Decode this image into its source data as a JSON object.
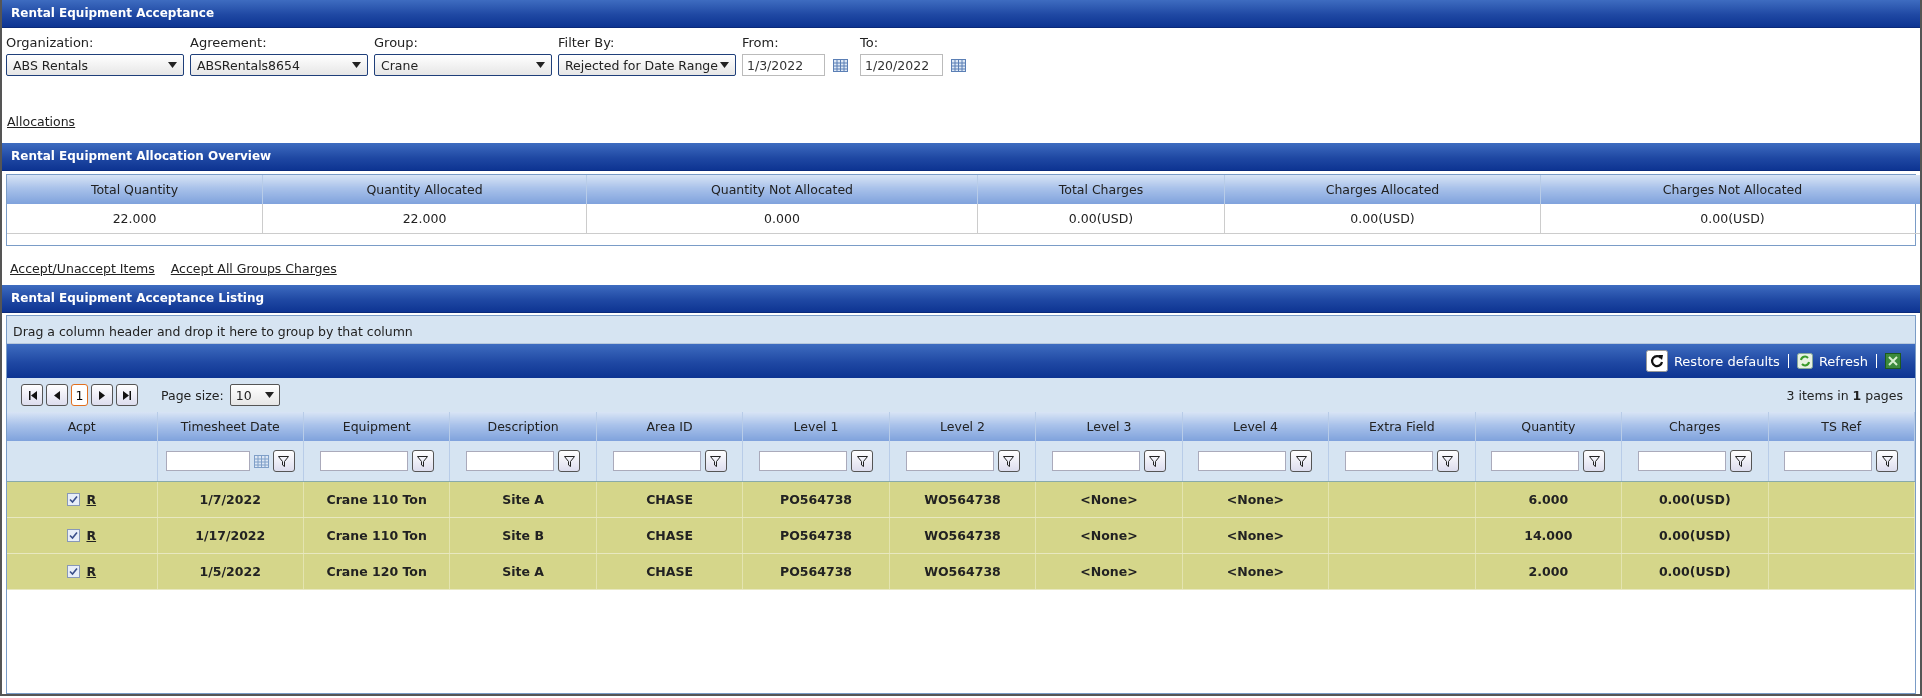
{
  "window": {
    "title": "Rental Equipment Acceptance"
  },
  "filters": [
    {
      "kind": "select",
      "label": "Organization:",
      "value": "ABS Rentals"
    },
    {
      "kind": "select",
      "label": "Agreement:",
      "value": "ABSRentals8654"
    },
    {
      "kind": "select",
      "label": "Group:",
      "value": "Crane"
    },
    {
      "kind": "select",
      "label": "Filter By:",
      "value": "Rejected for Date Range"
    },
    {
      "kind": "date",
      "label": "From:",
      "value": "1/3/2022"
    },
    {
      "kind": "date",
      "label": "To:",
      "value": "1/20/2022"
    }
  ],
  "allocations_link": "Allocations",
  "overview": {
    "title": "Rental Equipment Allocation Overview",
    "columns": [
      "Total Quantity",
      "Quantity Allocated",
      "Quantity Not Allocated",
      "Total Charges",
      "Charges Allocated",
      "Charges Not Allocated"
    ],
    "rows": [
      [
        "22.000",
        "22.000",
        "0.000",
        "0.00(USD)",
        "0.00(USD)",
        "0.00(USD)"
      ]
    ]
  },
  "action_links": [
    "Accept/Unaccept Items",
    "Accept All Groups Charges"
  ],
  "listing": {
    "title": "Rental Equipment Acceptance Listing",
    "group_hint": "Drag a column header and drop it here to group by that column",
    "toolbar": [
      {
        "kind": "restore",
        "label": "Restore defaults"
      },
      {
        "kind": "refresh",
        "label": "Refresh"
      },
      {
        "kind": "export"
      }
    ],
    "pager": {
      "pages": [
        {
          "label": "1",
          "selected": true
        }
      ],
      "page_size_label": "Page size:",
      "page_size": "10",
      "summary": "3 items in **1** pages"
    },
    "columns": [
      {
        "label": "Acpt",
        "kind": "none"
      },
      {
        "label": "Timesheet Date",
        "kind": "date"
      },
      {
        "label": "Equipment",
        "kind": "text"
      },
      {
        "label": "Description",
        "kind": "text"
      },
      {
        "label": "Area ID",
        "kind": "text"
      },
      {
        "label": "Level 1",
        "kind": "text"
      },
      {
        "label": "Level 2",
        "kind": "text"
      },
      {
        "label": "Level 3",
        "kind": "text"
      },
      {
        "label": "Level 4",
        "kind": "text"
      },
      {
        "label": "Extra Field",
        "kind": "text"
      },
      {
        "label": "Quantity",
        "kind": "text"
      },
      {
        "label": "Charges",
        "kind": "text"
      },
      {
        "label": "TS Ref",
        "kind": "text"
      }
    ],
    "rows": [
      {
        "checked": true,
        "cells": [
          "R",
          "1/7/2022",
          "Crane 110 Ton",
          "Site A",
          "CHASE",
          "PO564738",
          "WO564738",
          "<None>",
          "<None>",
          "",
          "6.000",
          "0.00(USD)",
          ""
        ]
      },
      {
        "checked": true,
        "cells": [
          "R",
          "1/17/2022",
          "Crane 110 Ton",
          "Site B",
          "CHASE",
          "PO564738",
          "WO564738",
          "<None>",
          "<None>",
          "",
          "14.000",
          "0.00(USD)",
          ""
        ]
      },
      {
        "checked": true,
        "cells": [
          "R",
          "1/5/2022",
          "Crane 120 Ton",
          "Site A",
          "CHASE",
          "PO564738",
          "WO564738",
          "<None>",
          "<None>",
          "",
          "2.000",
          "0.00(USD)",
          ""
        ]
      }
    ]
  }
}
